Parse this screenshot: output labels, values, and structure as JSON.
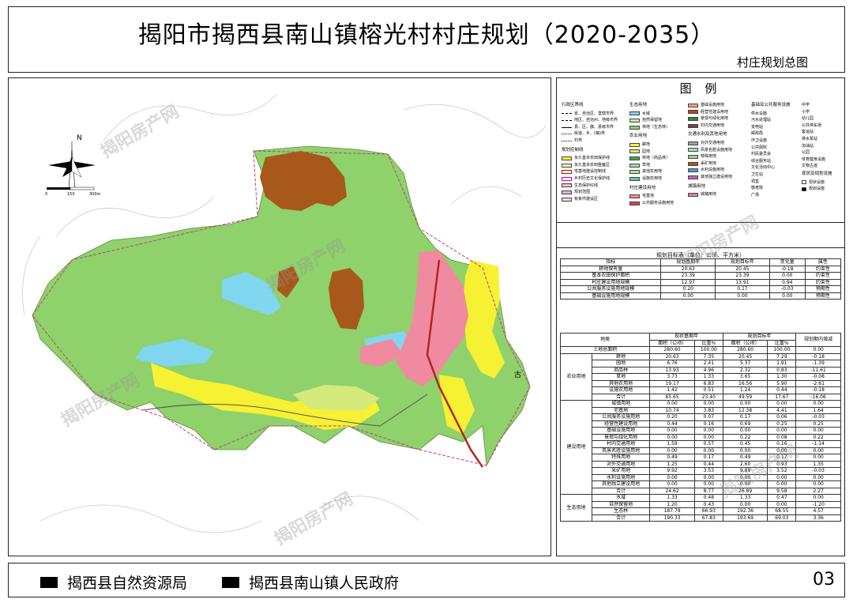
{
  "header": {
    "title": "揭阳市揭西县南山镇榕光村村庄规划（2020-2035）",
    "subtitle": "村庄规划总图"
  },
  "map": {
    "north_label": "N",
    "scale_ticks": [
      "0",
      "150",
      "300m"
    ],
    "place_labels": [
      "古"
    ],
    "colors": {
      "forest": "#8fd16a",
      "farmland": "#f6f132",
      "garden": "#d4ea7a",
      "village": "#f08aa0",
      "water": "#7fd6ee",
      "mine": "#a8581a",
      "road": "#b3261e"
    }
  },
  "legend": {
    "title": "图 例",
    "admin": {
      "head": "行政区界线",
      "items": [
        "省、自治区、直辖市界",
        "地区、自治州、地级市界",
        "县、区、旗、县级市界",
        "街道、乡、(镇)界",
        "村界"
      ]
    },
    "control": {
      "head": "规划控制线",
      "items": [
        "永久基本农田保护线",
        "永久基本农田整备区",
        "宅基地建设控制线",
        "乡村历史文化保护线",
        "生态保护红线",
        "规划范围",
        "有条件建设区"
      ]
    },
    "eco": {
      "head": "生态用地",
      "items": [
        "水域",
        "自然保留地",
        "林地（生态林）"
      ]
    },
    "agri": {
      "head": "农业用地",
      "items": [
        "耕地",
        "园地",
        "林地（商品林）",
        "草地",
        "其他农用地",
        "设施农用地"
      ]
    },
    "village": {
      "head": "村庄建设用地",
      "items": [
        "宅基地",
        "公共服务设施用地"
      ]
    },
    "infra": {
      "items": [
        "基础设施用地",
        "经营性建设用地",
        "景观与绿化用地",
        "村内交通用地"
      ]
    },
    "traffic": {
      "head": "交通水利及其他用地",
      "items": [
        "对外交通用地",
        "风景名胜设施用地",
        "特殊用地",
        "采矿用地",
        "水利设施用地",
        "其他独立建设用地"
      ]
    },
    "town": {
      "head": "城镇用地",
      "items": [
        "城镇用地"
      ]
    },
    "service": {
      "head": "基础及公共服务设施",
      "items": [
        "供水设施",
        "污水处理站",
        "变电站",
        "邮政局",
        "环卫设施",
        "公共厕所",
        "村民委员会",
        "综合服务站",
        "文化活动中心",
        "卫生站",
        "祠堂",
        "敬老院",
        "广场"
      ]
    },
    "school": {
      "items": [
        "中学",
        "小学",
        "幼儿园",
        "公共停车场",
        "客运站",
        "排水泵站",
        "加油站",
        "公园",
        "体育健身设施",
        "文物古迹"
      ]
    },
    "plan_marks": {
      "head": "现状及规划设施",
      "items": [
        "现状设施",
        "规划设施"
      ]
    }
  },
  "target_table": {
    "caption": "规划目标表（单位：公顷、平方米）",
    "headers": [
      "指标",
      "规划基期年",
      "规划目标年",
      "变化量",
      "属性"
    ],
    "rows": [
      [
        "耕地保有量",
        "20.63",
        "20.45",
        "-0.18",
        "约束性"
      ],
      [
        "基本农田保护面积",
        "23.39",
        "23.39",
        "0.00",
        "约束性"
      ],
      [
        "村庄建设用地规模",
        "12.97",
        "13.91",
        "0.94",
        "约束性"
      ],
      [
        "公共服务设施用地规模",
        "0.20",
        "0.17",
        "-0.03",
        "预期性"
      ],
      [
        "基础设施用地规模",
        "0.00",
        "0.00",
        "0.00",
        "预期性"
      ]
    ]
  },
  "landuse_table": {
    "head_type": "地类",
    "head_base": "现状基期年",
    "head_target": "规划目标年",
    "head_change": "规划期内增减",
    "sub_area": "面积（公顷）",
    "sub_ratio": "比重%",
    "total": [
      "土地总面积",
      "280.60",
      "100.00",
      "280.60",
      "100.00",
      "0.00"
    ],
    "groups": [
      {
        "name": "农业用地",
        "rows": [
          [
            "耕地",
            "20.63",
            "7.35",
            "20.45",
            "7.29",
            "-0.18"
          ],
          [
            "园地",
            "6.76",
            "2.41",
            "5.37",
            "1.91",
            "-1.39"
          ],
          [
            "商品林",
            "13.93",
            "4.96",
            "2.32",
            "0.83",
            "-11.61"
          ],
          [
            "草地",
            "3.73",
            "1.33",
            "3.65",
            "1.30",
            "-0.08"
          ],
          [
            "其他农用地",
            "19.17",
            "6.83",
            "16.56",
            "5.90",
            "-2.61"
          ],
          [
            "设施农用地",
            "1.42",
            "0.51",
            "1.24",
            "0.44",
            "-0.18"
          ],
          [
            "合计",
            "65.65",
            "23.40",
            "49.59",
            "17.67",
            "-16.06"
          ]
        ]
      },
      {
        "name": "建设用地",
        "sub1": "村庄建设用地",
        "sub2": "交通水利及其他用地",
        "rows": [
          [
            "城镇用地",
            "0.00",
            "0.00",
            "0.00",
            "0.00",
            "0.00"
          ],
          [
            "宅基地",
            "10.74",
            "3.83",
            "12.38",
            "4.41",
            "1.64"
          ],
          [
            "公共服务设施用地",
            "0.20",
            "0.07",
            "0.17",
            "0.06",
            "-0.03"
          ],
          [
            "经营性建设用地",
            "0.44",
            "0.16",
            "0.69",
            "0.25",
            "0.25"
          ],
          [
            "基础设施用地",
            "0.00",
            "0.00",
            "0.00",
            "0.00",
            "0.00"
          ],
          [
            "景观与绿化用地",
            "0.00",
            "0.00",
            "0.22",
            "0.08",
            "0.22"
          ],
          [
            "村内交通用地",
            "1.59",
            "0.57",
            "0.45",
            "0.16",
            "-1.14"
          ],
          [
            "风景名胜设施用地",
            "0.00",
            "0.00",
            "0.00",
            "0.00",
            "0.00"
          ],
          [
            "特殊用地",
            "0.49",
            "0.17",
            "0.49",
            "0.17",
            "0.00"
          ],
          [
            "对外交通用地",
            "1.25",
            "0.44",
            "2.60",
            "0.93",
            "1.35"
          ],
          [
            "采矿用地",
            "9.92",
            "3.53",
            "9.89",
            "3.52",
            "-0.03"
          ],
          [
            "水利设施用地",
            "0.00",
            "0.00",
            "0.00",
            "0.00",
            "0.00"
          ],
          [
            "其他独立建设用地",
            "0.00",
            "0.00",
            "0.00",
            "0.00",
            "0.00"
          ],
          [
            "合计",
            "24.62",
            "8.77",
            "26.89",
            "9.58",
            "2.27"
          ]
        ]
      },
      {
        "name": "生态用地",
        "rows": [
          [
            "水域",
            "1.33",
            "0.48",
            "1.33",
            "0.47",
            "0.00"
          ],
          [
            "自然保留地",
            "1.20",
            "0.43",
            "0.00",
            "0.00",
            "-1.20"
          ],
          [
            "生态林",
            "187.79",
            "66.93",
            "192.36",
            "68.55",
            "4.57"
          ],
          [
            "合计",
            "190.33",
            "67.83",
            "193.69",
            "69.03",
            "3.36"
          ]
        ]
      }
    ]
  },
  "footer": {
    "org1": "揭西县自然资源局",
    "org2": "揭西县南山镇人民政府",
    "page": "03"
  },
  "watermark": "揭阳房产网"
}
